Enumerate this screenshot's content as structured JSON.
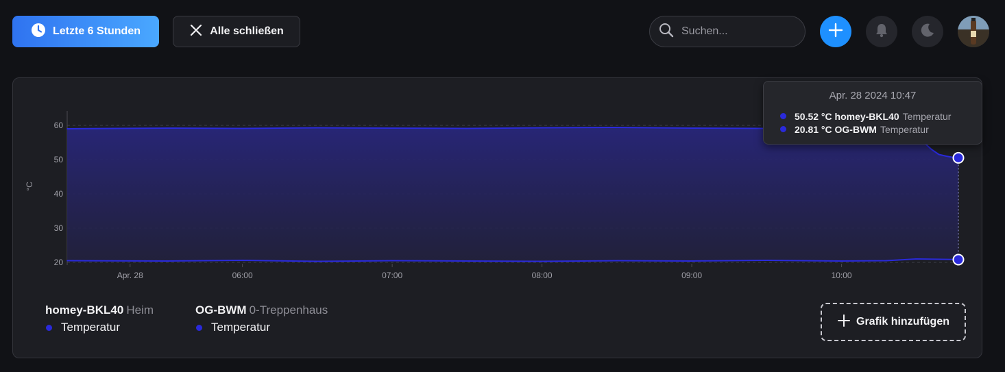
{
  "toolbar": {
    "time_range_label": "Letzte 6 Stunden",
    "close_all_label": "Alle schließen",
    "search_placeholder": "Suchen..."
  },
  "chart_data": {
    "type": "area",
    "ylabel": "°C",
    "xlabel": "",
    "ylim": [
      20,
      62
    ],
    "yticks": [
      20,
      30,
      40,
      50,
      60
    ],
    "x_tick_labels": [
      "Apr. 28",
      "06:00",
      "07:00",
      "08:00",
      "09:00",
      "10:00"
    ],
    "x_tick_hours": [
      5.25,
      6,
      7,
      8,
      9,
      10
    ],
    "x_range_hours": [
      4.83,
      10.78
    ],
    "grid": "horizontal-dashed",
    "series": [
      {
        "name": "homey-BKL40",
        "color": "#2a2adb",
        "x": [
          4.83,
          5.5,
          6.0,
          6.5,
          7.0,
          7.5,
          8.0,
          8.5,
          9.0,
          9.5,
          10.0,
          10.3,
          10.45,
          10.5,
          10.55,
          10.6,
          10.65,
          10.7,
          10.75,
          10.78
        ],
        "values": [
          59.0,
          59.2,
          59.1,
          59.3,
          59.2,
          59.1,
          59.3,
          59.4,
          59.2,
          59.1,
          59.3,
          59.2,
          59.0,
          57.5,
          55.0,
          53.0,
          51.5,
          51.0,
          50.6,
          50.52
        ]
      },
      {
        "name": "OG-BWM",
        "color": "#2a2adb",
        "x": [
          4.83,
          5.5,
          6.0,
          6.5,
          7.0,
          7.5,
          8.0,
          8.5,
          9.0,
          9.5,
          10.0,
          10.3,
          10.5,
          10.78
        ],
        "values": [
          20.5,
          20.4,
          20.6,
          20.3,
          20.5,
          20.4,
          20.3,
          20.5,
          20.4,
          20.6,
          20.4,
          20.5,
          21.0,
          20.81
        ]
      }
    ]
  },
  "tooltip": {
    "time": "Apr. 28 2024 10:47",
    "rows": [
      {
        "value": "50.52 °C homey-BKL40",
        "metric": "Temperatur"
      },
      {
        "value": "20.81 °C OG-BWM",
        "metric": "Temperatur"
      }
    ]
  },
  "legend": [
    {
      "name": "homey-BKL40",
      "location": "Heim",
      "metric": "Temperatur"
    },
    {
      "name": "OG-BWM",
      "location": "0-Treppenhaus",
      "metric": "Temperatur"
    }
  ],
  "add_graph_label": "Grafik hinzufügen",
  "colors": {
    "accent": "#1e90ff",
    "series": "#2a2adb"
  }
}
